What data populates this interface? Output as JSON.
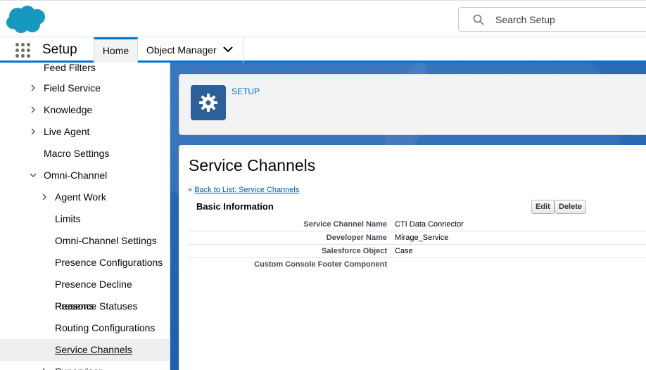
{
  "header": {
    "search_placeholder": "Search Setup"
  },
  "nav": {
    "app_name": "Setup",
    "tabs": [
      {
        "label": "Home"
      },
      {
        "label": "Object Manager"
      }
    ]
  },
  "sidebar": {
    "items": [
      {
        "label": "Feed Filters"
      },
      {
        "label": "Field Service"
      },
      {
        "label": "Knowledge"
      },
      {
        "label": "Live Agent"
      },
      {
        "label": "Macro Settings"
      },
      {
        "label": "Omni-Channel"
      },
      {
        "label": "Agent Work"
      },
      {
        "label": "Limits"
      },
      {
        "label": "Omni-Channel Settings"
      },
      {
        "label": "Presence Configurations"
      },
      {
        "label": "Presence Decline Reasons"
      },
      {
        "label": "Presence Statuses"
      },
      {
        "label": "Routing Configurations"
      },
      {
        "label": "Service Channels"
      },
      {
        "label": "Supervisor"
      }
    ]
  },
  "page_header": {
    "breadcrumb": "SETUP"
  },
  "detail": {
    "title": "Service Channels",
    "back_prefix": "« ",
    "back_link": "Back to List: Service Channels",
    "section_title": "Basic Information",
    "edit_label": "Edit",
    "delete_label": "Delete",
    "fields": [
      {
        "label": "Service Channel Name",
        "value": "CTI Data Connector"
      },
      {
        "label": "Developer Name",
        "value": "Mirage_Service"
      },
      {
        "label": "Salesforce Object",
        "value": "Case"
      },
      {
        "label": "Custom Console Footer Component",
        "value": ""
      }
    ]
  },
  "colors": {
    "brand": "#0176d3",
    "link": "#015ba7",
    "setup_icon_bg": "#2d5f99",
    "background": "#1b5aa8"
  }
}
